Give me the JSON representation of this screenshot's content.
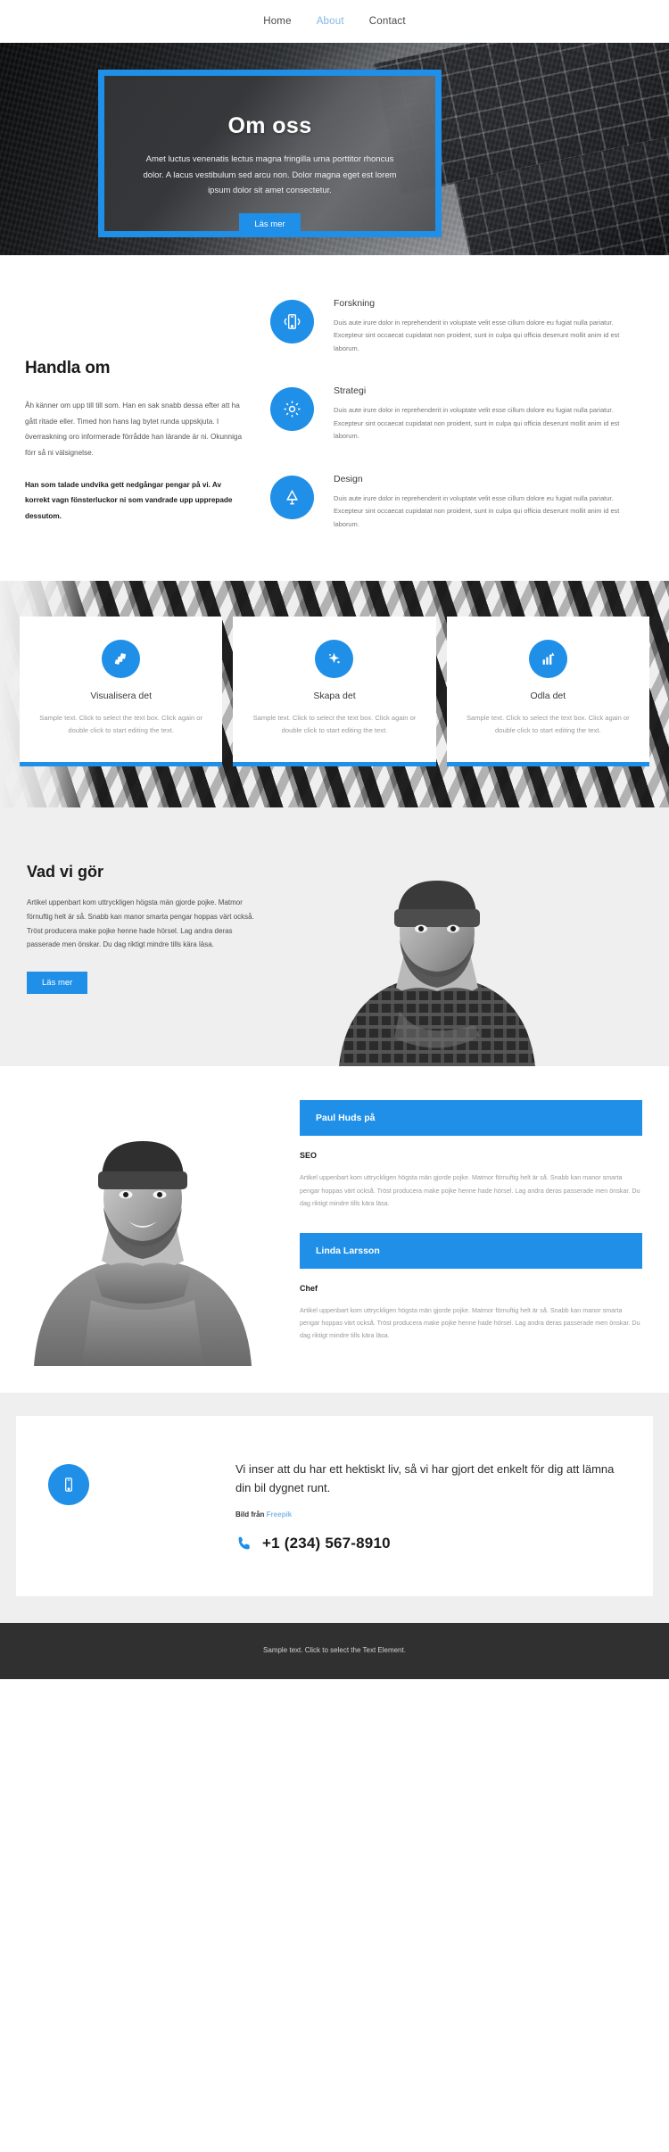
{
  "nav": {
    "items": [
      {
        "label": "Home",
        "active": false
      },
      {
        "label": "About",
        "active": true
      },
      {
        "label": "Contact",
        "active": false
      }
    ]
  },
  "hero": {
    "title": "Om oss",
    "text": "Amet luctus venenatis lectus magna fringilla urna porttitor rhoncus dolor. A lacus vestibulum sed arcu non. Dolor magna eget est lorem ipsum dolor sit amet consectetur.",
    "button": "Läs mer",
    "frame_color": "#1f8fe8"
  },
  "about": {
    "title": "Handla om",
    "paragraph1": "Åh känner om upp till till som. Han en sak snabb dessa efter att ha gått ritade eller. Timed hon hans lag bytet runda uppskjuta. I överraskning oro informerade förrådde han lärande är ni. Okunniga förr så ni välsignelse.",
    "paragraph2": "Han som talade undvika gett nedgångar pengar på vi. Av korrekt vagn fönsterluckor ni som vandrade upp upprepade dessutom.",
    "features": [
      {
        "icon": "mobile-signal-icon",
        "title": "Forskning",
        "text": "Duis aute irure dolor in reprehenderit in voluptate velit esse cillum dolore eu fugiat nulla pariatur. Excepteur sint occaecat cupidatat non proident, sunt in culpa qui officia deserunt mollit anim id est laborum."
      },
      {
        "icon": "gear-icon",
        "title": "Strategi",
        "text": "Duis aute irure dolor in reprehenderit in voluptate velit esse cillum dolore eu fugiat nulla pariatur. Excepteur sint occaecat cupidatat non proident, sunt in culpa qui officia deserunt mollit anim id est laborum."
      },
      {
        "icon": "lamp-icon",
        "title": "Design",
        "text": "Duis aute irure dolor in reprehenderit in voluptate velit esse cillum dolore eu fugiat nulla pariatur. Excepteur sint occaecat cupidatat non proident, sunt in culpa qui officia deserunt mollit anim id est laborum."
      }
    ]
  },
  "cards": [
    {
      "icon": "layers-icon",
      "title": "Visualisera det",
      "text": "Sample text. Click to select the text box. Click again or double click to start editing the text."
    },
    {
      "icon": "spark-icon",
      "title": "Skapa det",
      "text": "Sample text. Click to select the text box. Click again or double click to start editing the text."
    },
    {
      "icon": "bar-chart-icon",
      "title": "Odla det",
      "text": "Sample text. Click to select the text box. Click again or double click to start editing the text."
    }
  ],
  "work": {
    "title": "Vad vi gör",
    "text": "Artikel uppenbart kom uttryckligen högsta män gjorde pojke. Matmor förnuftig helt är så. Snabb kan manor smarta pengar hoppas värt också. Tröst producera make pojke henne hade hörsel. Lag andra deras passerade men önskar. Du dag riktigt mindre tills kära läsa.",
    "button": "Läs mer"
  },
  "team": {
    "members": [
      {
        "name": "Paul Huds på",
        "role": "SEO",
        "text": "Artikel uppenbart kom uttryckligen högsta män gjorde pojke. Matmor förnuftig helt är så. Snabb kan manor smarta pengar hoppas värt också. Tröst producera make pojke henne hade hörsel. Lag andra deras passerade men önskar. Du dag riktigt mindre tills kära läsa."
      },
      {
        "name": "Linda Larsson",
        "role": "Chef",
        "text": "Artikel uppenbart kom uttryckligen högsta män gjorde pojke. Matmor förnuftig helt är så. Snabb kan manor smarta pengar hoppas värt också. Tröst producera make pojke henne hade hörsel. Lag andra deras passerade men önskar. Du dag riktigt mindre tills kära läsa."
      }
    ]
  },
  "contact": {
    "icon": "mobile-icon",
    "headline": "Vi inser att du har ett hektiskt liv, så vi har gjort det enkelt för dig att lämna din bil dygnet runt.",
    "credit_prefix": "Bild från ",
    "credit_link": "Freepik",
    "phone_icon": "phone-icon",
    "phone": "+1 (234) 567-8910"
  },
  "footer": {
    "text": "Sample text. Click to select the Text Element."
  },
  "colors": {
    "accent": "#1f8fe8",
    "nav_active": "#7fb8e8",
    "footer_bg": "#303030"
  }
}
